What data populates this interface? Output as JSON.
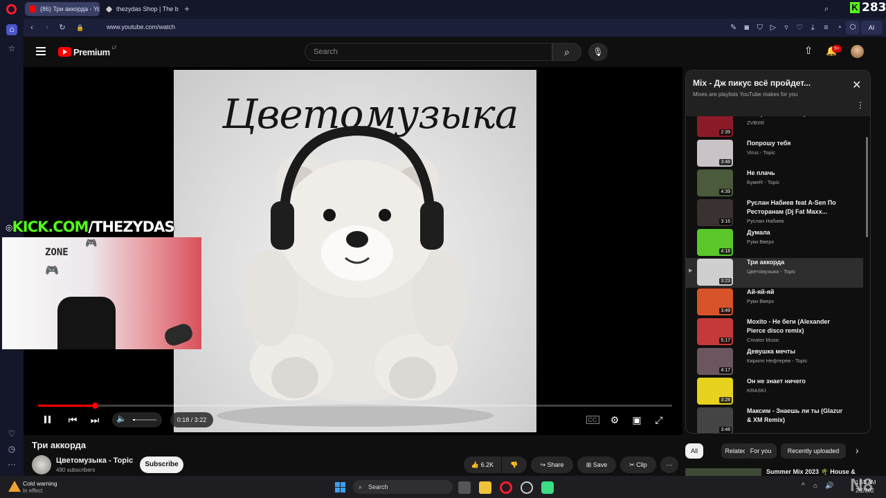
{
  "browser": {
    "tabs": [
      {
        "label": "(86) Три аккорда - Yo"
      },
      {
        "label": "thezydas Shop | The best"
      }
    ],
    "new_tab": "+",
    "url": "www.youtube.com/watch",
    "ai_label": "AI",
    "counter": "283"
  },
  "youtube": {
    "logo_text": "Premium",
    "region": "LT",
    "search_placeholder": "Search",
    "notif_badge": "9+"
  },
  "overlay": {
    "kick_green": "KICK.COM",
    "kick_white": "/THEZYDAS",
    "webcam_text": "ZONE"
  },
  "cover": {
    "title": "Цветомузыка"
  },
  "player": {
    "time": "0:18 / 3:22",
    "progress": 0.09,
    "volume": 0.1
  },
  "video": {
    "title": "Три аккорда",
    "channel": "Цветомузыка - Topic",
    "subscribers": "490 subscribers",
    "subscribe": "Subscribe",
    "likes": "6.2K",
    "share": "Share",
    "save": "Save",
    "clip": "Clip"
  },
  "mix": {
    "title": "Mix - Дж пикус всё пройдет...",
    "subtitle": "Mixes are playlists YouTube makes for you",
    "items": [
      {
        "title": "Alle (ZVBXR Remix)",
        "channel": "ZVBXR",
        "duration": "2:39",
        "color": "#8a1a26"
      },
      {
        "title": "Попрошу тебя",
        "channel": "Virus - Topic",
        "duration": "3:48",
        "color": "#c9c2c6"
      },
      {
        "title": "Не плачь",
        "channel": "БумеR - Topic",
        "duration": "4:39",
        "color": "#4a5a3a"
      },
      {
        "title": "Руслан Набиев feat A-Sen По Ресторанам (Dj Fat Maxx...",
        "channel": "Руслан Набиев",
        "duration": "3:16",
        "color": "#3a3230"
      },
      {
        "title": "Думала",
        "channel": "Руки Вверх",
        "duration": "4:18",
        "color": "#5bc72a"
      },
      {
        "title": "Три аккорда",
        "channel": "Цветомузыка - Topic",
        "duration": "3:23",
        "color": "#cfcfcf",
        "active": true
      },
      {
        "title": "Ай-яй-яй",
        "channel": "Руки Вверх",
        "duration": "3:49",
        "color": "#d8532a"
      },
      {
        "title": "Moxito - Не беги (Alexander Pierce disco remix)",
        "channel": "Creator Music",
        "duration": "5:17",
        "color": "#c5393a"
      },
      {
        "title": "Девушка мечты",
        "channel": "Кирилл Нефтерев - Topic",
        "duration": "4:17",
        "color": "#6b5660"
      },
      {
        "title": "Он не знает ничего",
        "channel": "KRASKI",
        "duration": "3:28",
        "color": "#e7d21e"
      },
      {
        "title": "Максим - Знаешь ли ты (Glazur & XM Remix)",
        "channel": "",
        "duration": "3:48",
        "color": "#444"
      }
    ],
    "play_marker": "▶"
  },
  "chips": [
    "All",
    "Related",
    "For you",
    "Recently uploaded"
  ],
  "next_video": {
    "title": "Summer Mix 2023 🌴 House &"
  },
  "taskbar": {
    "weather_title": "Cold warning",
    "weather_sub": "In effect",
    "search": "Search",
    "clock_time": "1:55 AM",
    "clock_date": "2/2/202",
    "corner_label": "N8"
  },
  "colors": {
    "accent": "#ff0000",
    "kick": "#53fc18",
    "opera": "#ff1b2d"
  }
}
